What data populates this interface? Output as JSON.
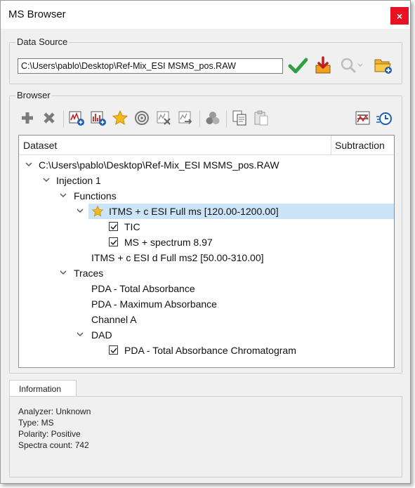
{
  "window": {
    "title": "MS Browser",
    "close_glyph": "×"
  },
  "data_source": {
    "label": "Data Source",
    "path": "C:\\Users\\pablo\\Desktop\\Ref-Mix_ESI MSMS_pos.RAW",
    "icons": [
      "check-icon",
      "download-icon",
      "search-zoom-icon",
      "open-folder-icon"
    ]
  },
  "browser": {
    "label": "Browser",
    "toolbar_icons": [
      "add-icon",
      "remove-icon",
      "add-chromatogram-icon",
      "add-spectrum-icon",
      "star-icon",
      "target-icon",
      "clear-icon",
      "export-icon",
      "cluster-icon",
      "copy-icon",
      "paste-icon",
      "chart-settings-icon",
      "timer-icon"
    ],
    "columns": {
      "dataset": "Dataset",
      "subtraction": "Subtraction"
    },
    "tree": [
      {
        "label": "C:\\Users\\pablo\\Desktop\\Ref-Mix_ESI MSMS_pos.RAW",
        "level": 0,
        "expanded": true
      },
      {
        "label": "Injection 1",
        "level": 1,
        "expanded": true
      },
      {
        "label": "Functions",
        "level": 2,
        "expanded": true
      },
      {
        "label": "ITMS + c ESI Full ms [120.00-1200.00]",
        "level": 3,
        "expanded": true,
        "starred": true,
        "selected": true
      },
      {
        "label": "TIC",
        "level": 4,
        "checked": true
      },
      {
        "label": "MS + spectrum 8.97",
        "level": 4,
        "checked": true
      },
      {
        "label": "ITMS + c ESI d Full ms2 [50.00-310.00]",
        "level": 3
      },
      {
        "label": "Traces",
        "level": 2,
        "expanded": true
      },
      {
        "label": "PDA - Total Absorbance",
        "level": 3
      },
      {
        "label": "PDA - Maximum Absorbance",
        "level": 3
      },
      {
        "label": "Channel A",
        "level": 3
      },
      {
        "label": "DAD",
        "level": 3,
        "expanded": true
      },
      {
        "label": "PDA - Total Absorbance Chromatogram",
        "level": 4,
        "checked": true
      }
    ]
  },
  "information": {
    "tab_label": "Information",
    "lines": [
      "Analyzer: Unknown",
      "Type: MS",
      "Polarity: Positive",
      "Spectra count: 742"
    ]
  },
  "colors": {
    "selection": "#cce4f7",
    "close": "#e81123",
    "accent_green": "#2ea043",
    "star": "#f5b820"
  }
}
